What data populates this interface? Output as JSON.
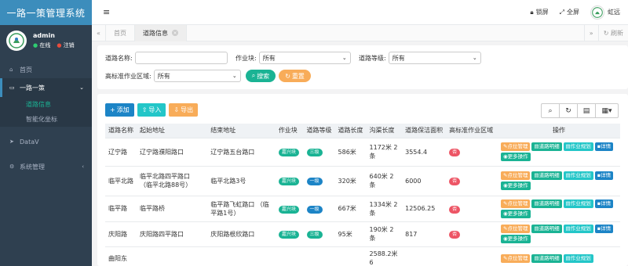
{
  "sidebar": {
    "brand": "一路一策管理系统",
    "user": {
      "name": "admin",
      "online": "在线",
      "logout": "注销"
    },
    "menu": {
      "home": "首页",
      "road_policy": "一路一策",
      "road_info": "道路信息",
      "smart_coord": "智能化坐标",
      "datav": "DataV",
      "system": "系统管理"
    }
  },
  "topbar": {
    "lock": "锁屏",
    "fullscreen": "全屏",
    "username": "虹远"
  },
  "tabs": {
    "items": [
      "首页",
      "道路信息"
    ],
    "refresh": "刷新"
  },
  "search": {
    "road_name_label": "道路名称:",
    "road_name_value": "",
    "work_block_label": "作业块:",
    "work_block_value": "所有",
    "road_level_label": "道路等级:",
    "road_level_value": "所有",
    "std_area_label": "高标准作业区域:",
    "std_area_value": "所有",
    "search_btn": "搜索",
    "reset_btn": "重置"
  },
  "toolbar": {
    "add": "添加",
    "import": "导入",
    "export": "导出"
  },
  "table": {
    "headers": [
      "道路名称",
      "起始地址",
      "结束地址",
      "作业块",
      "道路等级",
      "道路长度",
      "沟渠长度",
      "道路保洁面积",
      "高标准作业区域",
      "操作"
    ],
    "ops": {
      "point": "点位管理",
      "road_detail": "道路明细",
      "plan": "作业规划",
      "detail": "详情",
      "more": "更多操作"
    },
    "rows": [
      {
        "name": "辽宁路",
        "start": "辽宁路濮阳路口",
        "end": "辽宁路五台路口",
        "block": "嘉兴块",
        "level": "三级",
        "length": "586米",
        "ditch": "1172米 2条",
        "area": "3554.4",
        "std": "否"
      },
      {
        "name": "临平北路",
        "start": "临平北路四平路口 （临平北路88号）",
        "end": "临平北路3号",
        "block": "嘉兴块",
        "level": "一级",
        "length": "320米",
        "ditch": "640米 2条",
        "area": "6000",
        "std": "否"
      },
      {
        "name": "临平路",
        "start": "临平路桥",
        "end": "临平路飞虹路口 （临平路1号）",
        "block": "嘉兴块",
        "level": "一级",
        "length": "667米",
        "ditch": "1334米 2条",
        "area": "12506.25",
        "std": "否"
      },
      {
        "name": "庆阳路",
        "start": "庆阳路四平路口",
        "end": "庆阳路根欣路口",
        "block": "嘉兴块",
        "level": "三级",
        "length": "95米",
        "ditch": "190米 2条",
        "area": "817",
        "std": "否"
      },
      {
        "name": "曲阳东",
        "start": "",
        "end": "",
        "block": "",
        "level": "",
        "length": "",
        "ditch": "2588.2米 6",
        "area": "",
        "std": ""
      }
    ]
  }
}
